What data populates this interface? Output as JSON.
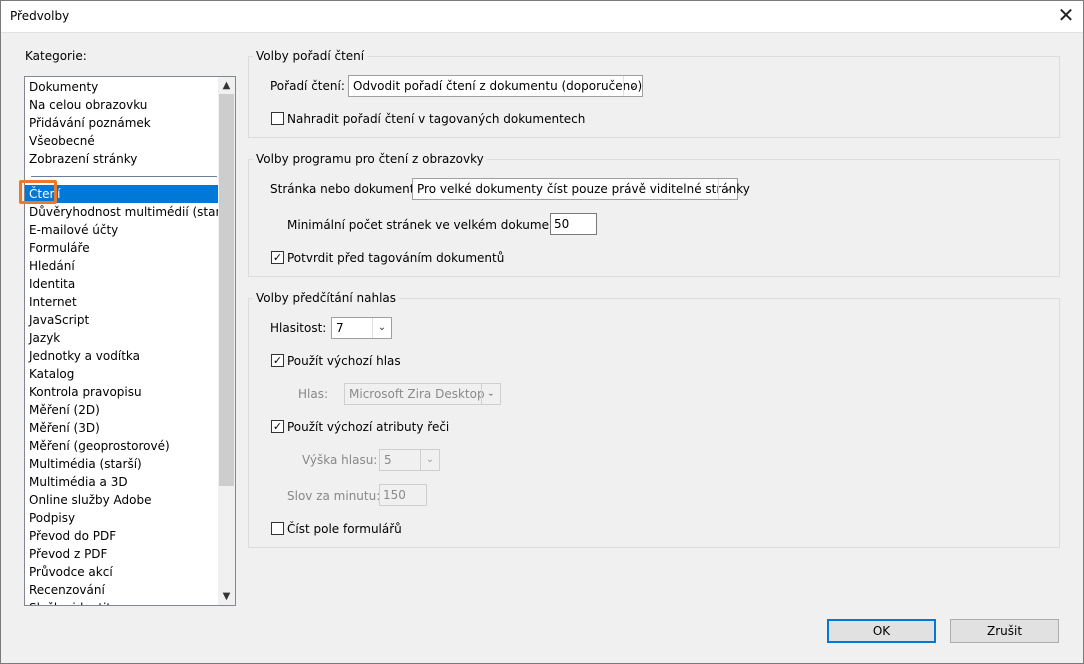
{
  "window": {
    "title": "Předvolby",
    "close_glyph": "✕"
  },
  "categories": {
    "label": "Kategorie:",
    "items_top": [
      "Dokumenty",
      "Na celou obrazovku",
      "Přidávání poznámek",
      "Všeobecné",
      "Zobrazení stránky"
    ],
    "selected": "Čtení",
    "items_rest": [
      "Důvěryhodnost multimédií (starší)",
      "E-mailové účty",
      "Formuláře",
      "Hledání",
      "Identita",
      "Internet",
      "JavaScript",
      "Jazyk",
      "Jednotky a vodítka",
      "Katalog",
      "Kontrola pravopisu",
      "Měření (2D)",
      "Měření (3D)",
      "Měření (geoprostorové)",
      "Multimédia (starší)",
      "Multimédia a 3D",
      "Online služby Adobe",
      "Podpisy",
      "Převod do PDF",
      "Převod z PDF",
      "Průvodce akcí",
      "Recenzování",
      "Služby identit"
    ],
    "selection_color": "#0078d7",
    "highlight_color": "#e97a2c"
  },
  "reading_order": {
    "group_title": "Volby pořadí čtení",
    "order_label": "Pořadí čtení:",
    "order_value": "Odvodit pořadí čtení z dokumentu (doporučeno)",
    "override_label": "Nahradit pořadí čtení v tagovaných dokumentech",
    "override_checked": false
  },
  "screen_reader": {
    "group_title": "Volby programu pro čtení z obrazovky",
    "page_label": "Stránka nebo dokument:",
    "page_value": "Pro velké dokumenty číst pouze právě viditelné stránky",
    "min_pages_label": "Minimální počet stránek ve velkém dokumentu:",
    "min_pages_value": "50",
    "confirm_label": "Potvrdit před tagováním dokumentů",
    "confirm_checked": true
  },
  "read_out_loud": {
    "group_title": "Volby předčítání nahlas",
    "volume_label": "Hlasitost:",
    "volume_value": "7",
    "default_voice_label": "Použít výchozí hlas",
    "default_voice_checked": true,
    "voice_label": "Hlas:",
    "voice_value": "Microsoft Zira Desktop -",
    "default_attrs_label": "Použít výchozí atributy řeči",
    "default_attrs_checked": true,
    "pitch_label": "Výška hlasu:",
    "pitch_value": "5",
    "wpm_label": "Slov za minutu:",
    "wpm_value": "150",
    "form_fields_label": "Číst pole formulářů",
    "form_fields_checked": false
  },
  "buttons": {
    "ok": "OK",
    "cancel": "Zrušit"
  },
  "icons": {
    "check": "✓",
    "dropdown": "⌄",
    "scroll_up": "▲",
    "scroll_down": "▼"
  }
}
